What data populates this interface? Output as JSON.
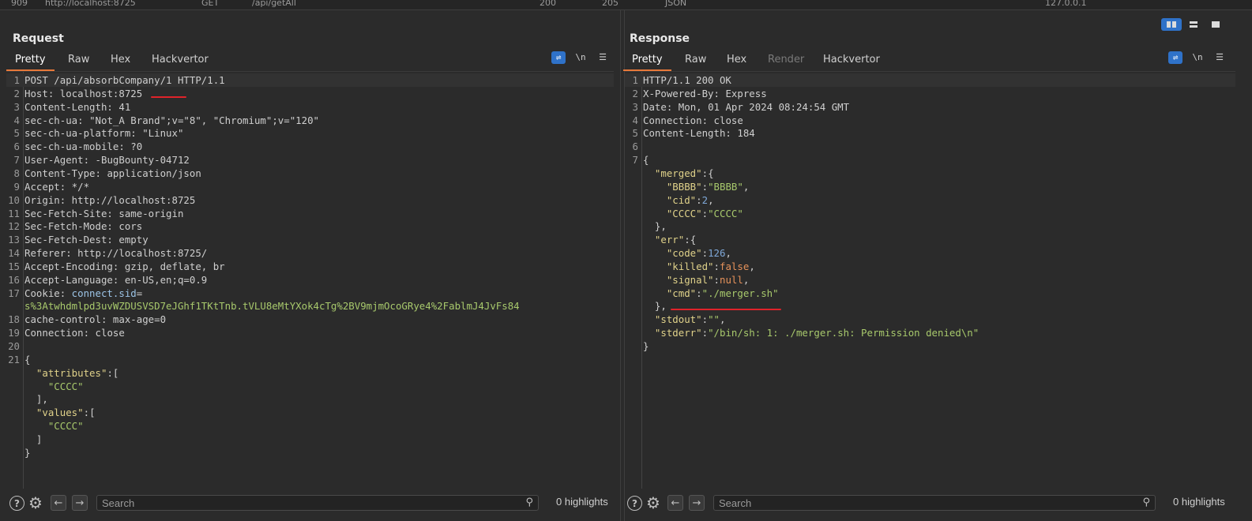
{
  "history_row": {
    "num": "909",
    "host": "http://localhost:8725",
    "method": "GET",
    "url": "/api/getAll",
    "status": "200",
    "length": "205",
    "mime": "JSON",
    "ip": "127.0.0.1"
  },
  "request": {
    "title": "Request",
    "tabs": [
      "Pretty",
      "Raw",
      "Hex",
      "Hackvertor"
    ],
    "active_tab": "Pretty",
    "icons": {
      "wrap": "wrap-lines-icon",
      "newline": "\\n",
      "menu": "menu-icon"
    },
    "search_placeholder": "Search",
    "highlights": "0 highlights"
  },
  "response": {
    "title": "Response",
    "tabs": [
      "Pretty",
      "Raw",
      "Hex",
      "Render",
      "Hackvertor"
    ],
    "active_tab": "Pretty",
    "disabled_tab": "Render",
    "icons": {
      "wrap": "wrap-lines-icon",
      "newline": "\\n",
      "menu": "menu-icon"
    },
    "search_placeholder": "Search",
    "highlights": "0 highlights"
  },
  "request_lines": [
    {
      "n": "1",
      "t": "POST /api/absorbCompany/1 HTTP/1.1"
    },
    {
      "n": "2",
      "k": "Host:",
      "v": " localhost:8725"
    },
    {
      "n": "3",
      "k": "Content-Length:",
      "v": " 41"
    },
    {
      "n": "4",
      "k": "sec-ch-ua:",
      "v": " \"Not_A Brand\";v=\"8\", \"Chromium\";v=\"120\""
    },
    {
      "n": "5",
      "k": "sec-ch-ua-platform:",
      "v": " \"Linux\""
    },
    {
      "n": "6",
      "k": "sec-ch-ua-mobile:",
      "v": " ?0"
    },
    {
      "n": "7",
      "k": "User-Agent:",
      "v": " -BugBounty-04712"
    },
    {
      "n": "8",
      "k": "Content-Type:",
      "v": " application/json"
    },
    {
      "n": "9",
      "k": "Accept:",
      "v": " */*"
    },
    {
      "n": "10",
      "k": "Origin:",
      "v": " http://localhost:8725"
    },
    {
      "n": "11",
      "k": "Sec-Fetch-Site:",
      "v": " same-origin"
    },
    {
      "n": "12",
      "k": "Sec-Fetch-Mode:",
      "v": " cors"
    },
    {
      "n": "13",
      "k": "Sec-Fetch-Dest:",
      "v": " empty"
    },
    {
      "n": "14",
      "k": "Referer:",
      "v": " http://localhost:8725/"
    },
    {
      "n": "15",
      "k": "Accept-Encoding:",
      "v": " gzip, deflate, br"
    },
    {
      "n": "16",
      "k": "Accept-Language:",
      "v": " en-US,en;q=0.9"
    },
    {
      "n": "17",
      "k": "Cookie:",
      "c": " connect.sid",
      "v": "="
    },
    {
      "n": "",
      "s": "s%3Atwhdmlpd3uvWZDUSVSD7eJGhf1TKtTnb.tVLU8eMtYXok4cTg%2BV9mjmOcoGRye4%2FablmJ4JvFs84"
    },
    {
      "n": "18",
      "k": "cache-control:",
      "v": " max-age=0"
    },
    {
      "n": "19",
      "k": "Connection:",
      "v": " close"
    },
    {
      "n": "20",
      "t": ""
    },
    {
      "n": "21",
      "t": "{"
    },
    {
      "n": "",
      "t": "  ",
      "jk": "\"attributes\"",
      "t2": ":["
    },
    {
      "n": "",
      "t": "    ",
      "js": "\"CCCC\""
    },
    {
      "n": "",
      "t": "  ],"
    },
    {
      "n": "",
      "t": "  ",
      "jk": "\"values\"",
      "t2": ":["
    },
    {
      "n": "",
      "t": "    ",
      "js": "\"CCCC\""
    },
    {
      "n": "",
      "t": "  ]"
    },
    {
      "n": "",
      "t": "}"
    }
  ],
  "response_lines": [
    {
      "n": "1",
      "t": "HTTP/1.1 200 OK"
    },
    {
      "n": "2",
      "k": "X-Powered-By:",
      "v": " Express"
    },
    {
      "n": "3",
      "k": "Date:",
      "v": " Mon, 01 Apr 2024 08:24:54 GMT"
    },
    {
      "n": "4",
      "k": "Connection:",
      "v": " close"
    },
    {
      "n": "5",
      "k": "Content-Length:",
      "v": " 184"
    },
    {
      "n": "6",
      "t": ""
    },
    {
      "n": "7",
      "t": "{"
    },
    {
      "n": "",
      "t": "  ",
      "jk": "\"merged\"",
      "t2": ":{"
    },
    {
      "n": "",
      "t": "    ",
      "jk": "\"BBBB\"",
      "t2": ":",
      "js": "\"BBBB\"",
      "t3": ","
    },
    {
      "n": "",
      "t": "    ",
      "jk": "\"cid\"",
      "t2": ":",
      "jn": "2",
      "t3": ","
    },
    {
      "n": "",
      "t": "    ",
      "jk": "\"CCCC\"",
      "t2": ":",
      "js": "\"CCCC\""
    },
    {
      "n": "",
      "t": "  },"
    },
    {
      "n": "",
      "t": "  ",
      "jk": "\"err\"",
      "t2": ":{"
    },
    {
      "n": "",
      "t": "    ",
      "jk": "\"code\"",
      "t2": ":",
      "jn": "126",
      "t3": ","
    },
    {
      "n": "",
      "t": "    ",
      "jk": "\"killed\"",
      "t2": ":",
      "jw": "false",
      "t3": ","
    },
    {
      "n": "",
      "t": "    ",
      "jk": "\"signal\"",
      "t2": ":",
      "jw": "null",
      "t3": ","
    },
    {
      "n": "",
      "t": "    ",
      "jk": "\"cmd\"",
      "t2": ":",
      "js": "\"./merger.sh\""
    },
    {
      "n": "",
      "t": "  },"
    },
    {
      "n": "",
      "t": "  ",
      "jk": "\"stdout\"",
      "t2": ":",
      "js": "\"\"",
      "t3": ","
    },
    {
      "n": "",
      "t": "  ",
      "jk": "\"stderr\"",
      "t2": ":",
      "js": "\"/bin/sh: 1: ./merger.sh: Permission denied\\n\""
    },
    {
      "n": "",
      "t": "}"
    }
  ],
  "colors": {
    "accent": "#e8793a",
    "selected_blue": "#2f72c9",
    "annotation_red": "#e0232a"
  }
}
